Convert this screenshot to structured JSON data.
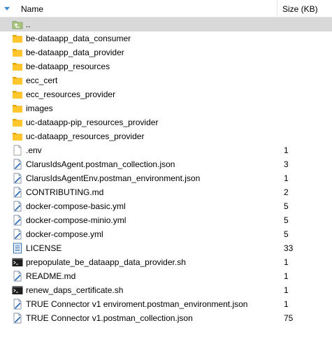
{
  "columns": {
    "name": "Name",
    "size": "Size (KB)"
  },
  "colors": {
    "folder": "#ffc72b",
    "selected_row": "#d9d9d9",
    "header_divider": "#e5e5e5"
  },
  "rows": [
    {
      "name": "..",
      "size": "",
      "icon": "folder-up-icon",
      "selected": true
    },
    {
      "name": "be-dataapp_data_consumer",
      "size": "",
      "icon": "folder-icon"
    },
    {
      "name": "be-dataapp_data_provider",
      "size": "",
      "icon": "folder-icon"
    },
    {
      "name": "be-dataapp_resources",
      "size": "",
      "icon": "folder-icon"
    },
    {
      "name": "ecc_cert",
      "size": "",
      "icon": "folder-icon"
    },
    {
      "name": "ecc_resources_provider",
      "size": "",
      "icon": "folder-icon"
    },
    {
      "name": "images",
      "size": "",
      "icon": "folder-icon"
    },
    {
      "name": "uc-dataapp-pip_resources_provider",
      "size": "",
      "icon": "folder-icon"
    },
    {
      "name": "uc-dataapp_resources_provider",
      "size": "",
      "icon": "folder-icon"
    },
    {
      "name": ".env",
      "size": "1",
      "icon": "blank-file-icon"
    },
    {
      "name": "ClarusIdsAgent.postman_collection.json",
      "size": "3",
      "icon": "script-file-icon"
    },
    {
      "name": "ClarusIdsAgentEnv.postman_environment.json",
      "size": "1",
      "icon": "script-file-icon"
    },
    {
      "name": "CONTRIBUTING.md",
      "size": "2",
      "icon": "script-file-icon"
    },
    {
      "name": "docker-compose-basic.yml",
      "size": "5",
      "icon": "script-file-icon"
    },
    {
      "name": "docker-compose-minio.yml",
      "size": "5",
      "icon": "script-file-icon"
    },
    {
      "name": "docker-compose.yml",
      "size": "5",
      "icon": "script-file-icon"
    },
    {
      "name": "LICENSE",
      "size": "33",
      "icon": "text-document-icon"
    },
    {
      "name": "prepopulate_be_dataapp_data_provider.sh",
      "size": "1",
      "icon": "terminal-icon"
    },
    {
      "name": "README.md",
      "size": "1",
      "icon": "script-file-icon"
    },
    {
      "name": "renew_daps_certificate.sh",
      "size": "1",
      "icon": "terminal-icon"
    },
    {
      "name": "TRUE Connector v1 enviroment.postman_environment.json",
      "size": "1",
      "icon": "script-file-icon"
    },
    {
      "name": "TRUE Connector v1.postman_collection.json",
      "size": "75",
      "icon": "script-file-icon"
    }
  ]
}
